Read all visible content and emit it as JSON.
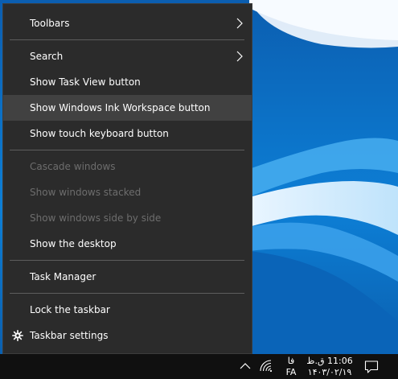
{
  "context_menu": {
    "items": [
      {
        "label": "Toolbars",
        "submenu": true
      },
      {
        "label": "Search",
        "submenu": true
      },
      {
        "label": "Show Task View button"
      },
      {
        "label": "Show Windows Ink Workspace button",
        "hovered": true
      },
      {
        "label": "Show touch keyboard button"
      },
      {
        "label": "Cascade windows",
        "disabled": true
      },
      {
        "label": "Show windows stacked",
        "disabled": true
      },
      {
        "label": "Show windows side by side",
        "disabled": true
      },
      {
        "label": "Show the desktop"
      },
      {
        "label": "Task Manager"
      },
      {
        "label": "Lock the taskbar"
      },
      {
        "label": "Taskbar settings",
        "icon": "gear-icon"
      }
    ]
  },
  "taskbar": {
    "language_short": "فا",
    "language_code": "FA",
    "time": "11:06 ق.ظ",
    "date": "۱۴۰۳/۰۲/۱۹",
    "icons": [
      "chevron-up-icon",
      "wifi-icon",
      "notification-icon"
    ]
  },
  "colors": {
    "menu_bg": "#2b2b2b",
    "menu_hover": "#414141",
    "menu_disabled_text": "#6d6d6d",
    "taskbar_bg": "#101010"
  }
}
